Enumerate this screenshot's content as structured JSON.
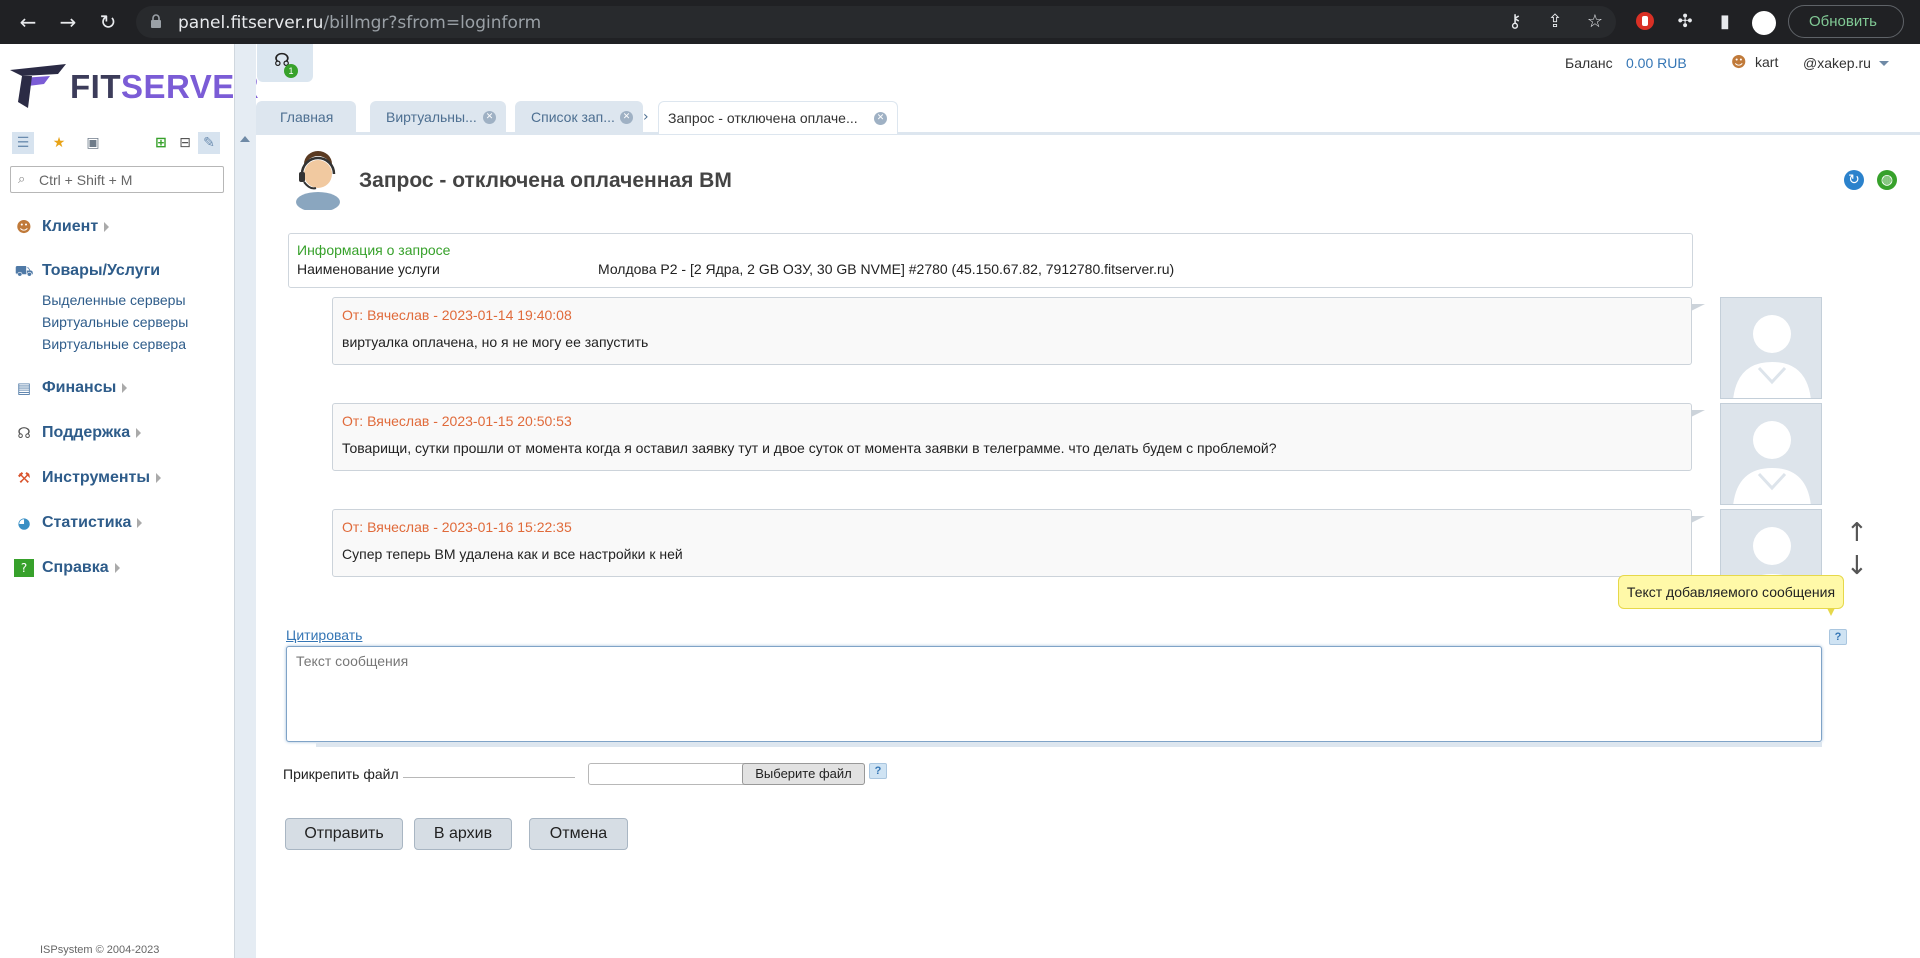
{
  "browser": {
    "url_host": "panel.fitserver.ru",
    "url_path": "/billmgr?sfrom=loginform",
    "update_label": "Обновить"
  },
  "sidebar": {
    "logo_fit": "FIT",
    "logo_server": "SERVER",
    "search_placeholder": "Ctrl + Shift + M",
    "menu": [
      {
        "label": "Клиент",
        "icon": "client-icon"
      },
      {
        "label": "Товары/Услуги",
        "icon": "cart-icon"
      },
      {
        "label": "Финансы",
        "icon": "finance-icon"
      },
      {
        "label": "Поддержка",
        "icon": "support-icon"
      },
      {
        "label": "Инструменты",
        "icon": "tools-icon"
      },
      {
        "label": "Статистика",
        "icon": "statistics-icon"
      },
      {
        "label": "Справка",
        "icon": "help-book-icon"
      }
    ],
    "submenu": [
      "Выделенные серверы",
      "Виртуальные серверы",
      "Виртуальные сервера"
    ],
    "footer": "ISPsystem © 2004-2023"
  },
  "header": {
    "notify_count": "1",
    "balance_label": "Баланс",
    "balance_value": "0.00 RUB",
    "user": "kart",
    "domain": "@xakep.ru"
  },
  "tabs": [
    {
      "label": "Главная",
      "closable": false
    },
    {
      "label": "Виртуальны...",
      "closable": true
    },
    {
      "label": "Список зап...",
      "closable": true
    },
    {
      "label": "Запрос - отключена оплаче...",
      "closable": true,
      "active": true
    }
  ],
  "page": {
    "title": "Запрос - отключена оплаченная ВМ",
    "info_title": "Информация о запросе",
    "info_label": "Наименование услуги",
    "info_value": "Молдова P2 - [2 Ядра, 2 GB ОЗУ, 30 GB NVME] #2780 (45.150.67.82, 7912780.fitserver.ru)"
  },
  "messages": [
    {
      "header": "От: Вячеслав - 2023-01-14 19:40:08",
      "body": "виртуалка оплачена, но я не могу ее запустить"
    },
    {
      "header": "От: Вячеслав - 2023-01-15 20:50:53",
      "body": "Товарищи, сутки прошли от момента когда я оставил заявку тут и двое суток от момента заявки в телеграмме. что делать будем с проблемой?"
    },
    {
      "header": "От: Вячеслав - 2023-01-16 15:22:35",
      "body": "Супер теперь ВМ удалена как и все настройки к ней"
    }
  ],
  "form": {
    "tooltip": "Текст добавляемого сообщения",
    "quote_label": "Цитировать",
    "message_placeholder": "Текст сообщения",
    "attach_label": "Прикрепить файл",
    "choose_file": "Выберите файл",
    "help_mark": "?",
    "send": "Отправить",
    "archive": "В архив",
    "cancel": "Отмена"
  },
  "colors": {
    "accent": "#2e5c8a",
    "message_header": "#e06a3a",
    "info_title": "#37a12b",
    "brand_purple": "#7b5cd6"
  }
}
